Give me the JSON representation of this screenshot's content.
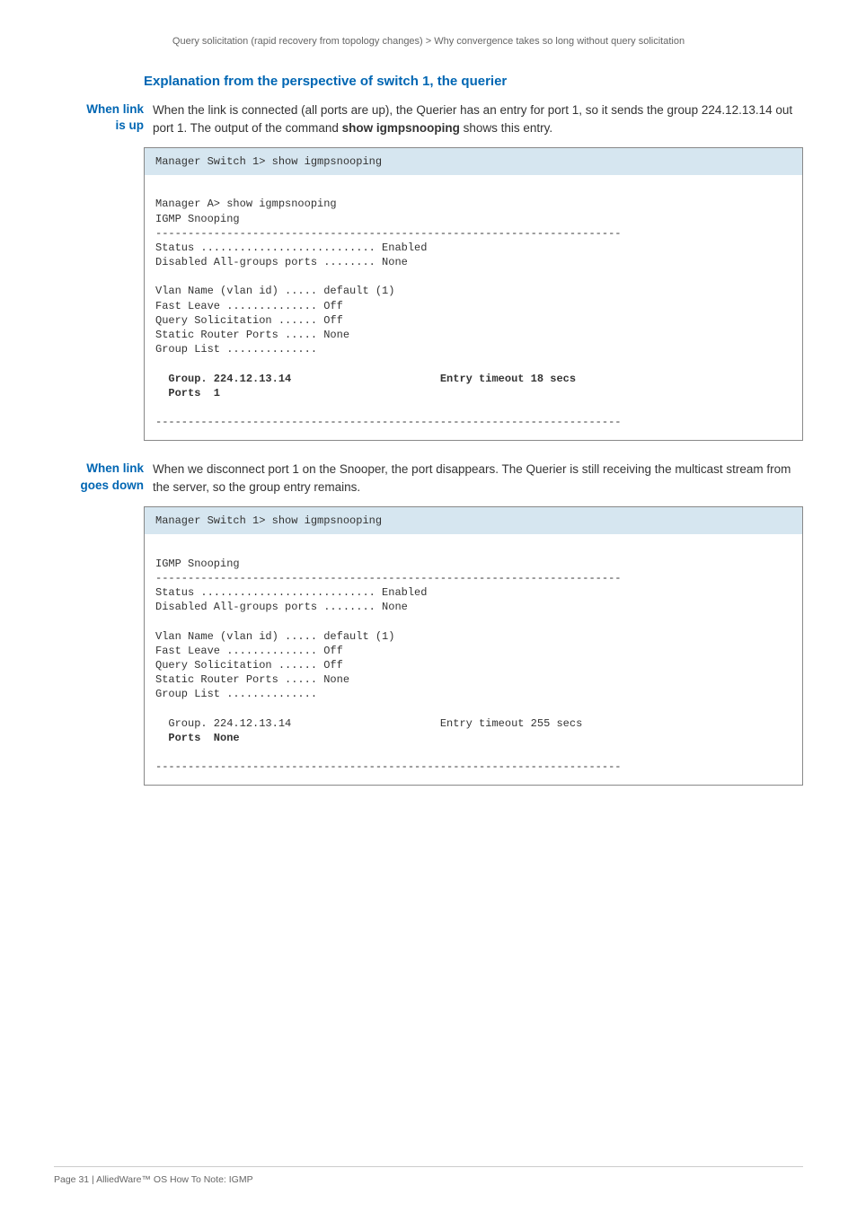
{
  "breadcrumb": "Query solicitation (rapid recovery from topology changes)   >   Why convergence takes so long without query solicitation",
  "section_title": "Explanation from the perspective of switch 1, the querier",
  "block1": {
    "side_l1": "When link",
    "side_l2": "is up",
    "para": "When the link is connected (all ports are up), the Querier has an entry for port 1, so it sends the group 224.12.13.14 out port 1. The output of the command ",
    "para_bold": "show igmpsnooping",
    "para_tail": " shows this entry."
  },
  "code1": {
    "header": "Manager Switch 1> show igmpsnooping",
    "body": "\nManager A> show igmpsnooping\nIGMP Snooping\n------------------------------------------------------------------------\nStatus ........................... Enabled\nDisabled All-groups ports ........ None\n\nVlan Name (vlan id) ..... default (1)\nFast Leave .............. Off\nQuery Solicitation ...... Off\nStatic Router Ports ..... None\nGroup List ..............\n\n  Group. 224.12.13.14                       Entry timeout 18 secs\n  Ports  1\n\n------------------------------------------------------------------------\n"
  },
  "block2": {
    "side_l1": "When link",
    "side_l2": "goes down",
    "para": "When we disconnect port 1 on the Snooper, the port disappears. The Querier is still receiving the multicast stream from the server, so the group entry remains."
  },
  "code2": {
    "header": "Manager Switch 1> show igmpsnooping",
    "body": "\nIGMP Snooping\n------------------------------------------------------------------------\nStatus ........................... Enabled\nDisabled All-groups ports ........ None\n\nVlan Name (vlan id) ..... default (1)\nFast Leave .............. Off\nQuery Solicitation ...... Off\nStatic Router Ports ..... None\nGroup List ..............\n\n  Group. 224.12.13.14                       Entry timeout 255 secs\n  Ports  None\n\n------------------------------------------------------------------------\n"
  },
  "code1_bold_lines": [
    "  Group. 224.12.13.14                       Entry timeout 18 secs",
    "  Ports  1"
  ],
  "code2_bold_lines": [
    "  Ports  None"
  ],
  "footer": "Page 31 | AlliedWare™ OS How To Note: IGMP"
}
